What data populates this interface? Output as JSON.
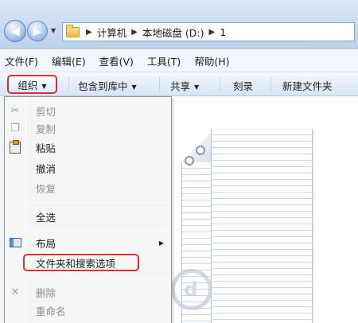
{
  "address": {
    "crumbs": [
      "计算机",
      "本地磁盘 (D:)",
      "1"
    ]
  },
  "menubar": {
    "items": [
      "文件(F)",
      "编辑(E)",
      "查看(V)",
      "工具(T)",
      "帮助(H)"
    ]
  },
  "commandbar": {
    "organize": "组织",
    "include_in_library": "包含到库中",
    "share": "共享",
    "burn": "刻录",
    "new_folder": "新建文件夹"
  },
  "dropdown": {
    "cut": "剪切",
    "copy": "复制",
    "paste": "粘贴",
    "undo": "撤消",
    "redo": "恢复",
    "select_all": "全选",
    "layout": "布局",
    "folder_options": "文件夹和搜索选项",
    "delete": "删除",
    "rename": "重命名"
  },
  "colors": {
    "highlight_border": "#d8303a",
    "menu_bg": "#f5f5f5"
  }
}
